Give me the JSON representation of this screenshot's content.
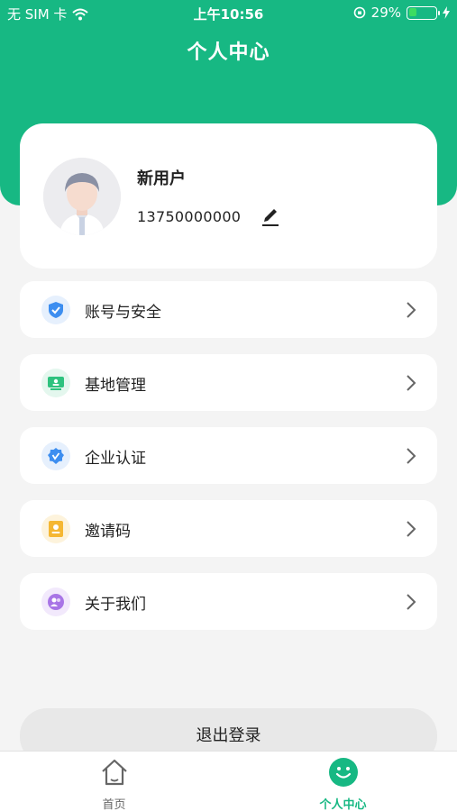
{
  "status_bar": {
    "carrier": "无 SIM 卡",
    "time": "上午10:56",
    "battery_percent": "29%",
    "battery_level": 0.29
  },
  "header": {
    "title": "个人中心",
    "color": "#17b883"
  },
  "profile": {
    "name": "新用户",
    "phone": "13750000000"
  },
  "menu": {
    "items": [
      {
        "label": "账号与安全",
        "icon": "shield-check-icon",
        "color": "#3d8ef0"
      },
      {
        "label": "基地管理",
        "icon": "monitor-icon",
        "color": "#2ec27e"
      },
      {
        "label": "企业认证",
        "icon": "badge-check-icon",
        "color": "#3d8ef0"
      },
      {
        "label": "邀请码",
        "icon": "card-icon",
        "color": "#f5b733"
      },
      {
        "label": "关于我们",
        "icon": "people-icon",
        "color": "#a875e6"
      }
    ]
  },
  "logout": {
    "label": "退出登录"
  },
  "tab_bar": {
    "tabs": [
      {
        "label": "首页",
        "icon": "home-icon",
        "active": false
      },
      {
        "label": "个人中心",
        "icon": "smile-icon",
        "active": true
      }
    ]
  }
}
